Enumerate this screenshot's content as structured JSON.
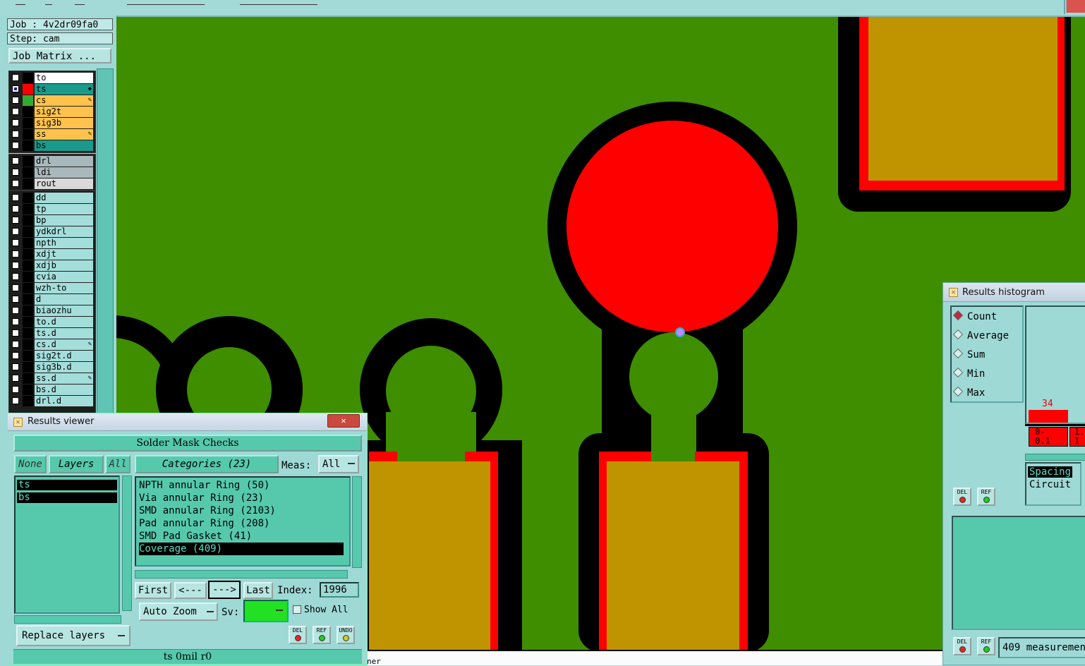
{
  "left_panel": {
    "job": "Job : 4v2dr09fa0",
    "step": "Step: cam",
    "job_matrix": "Job Matrix ...",
    "layers_group1": [
      {
        "name": "to",
        "color": "#ffffff",
        "swatch": "#000000",
        "checked": false,
        "mark": ""
      },
      {
        "name": "ts",
        "color": "#1a9a8a",
        "swatch": "#ff0000",
        "checked": true,
        "mark": "◆"
      },
      {
        "name": "cs",
        "color": "#ffc34d",
        "swatch": "#33aa33",
        "checked": false,
        "mark": "✎"
      },
      {
        "name": "sig2t",
        "color": "#ffc34d",
        "swatch": "#000000",
        "checked": false,
        "mark": ""
      },
      {
        "name": "sig3b",
        "color": "#ffc34d",
        "swatch": "#000000",
        "checked": false,
        "mark": ""
      },
      {
        "name": "ss",
        "color": "#ffc34d",
        "swatch": "#000000",
        "checked": false,
        "mark": "✎"
      },
      {
        "name": "bs",
        "color": "#1a9a8a",
        "swatch": "#000000",
        "checked": false,
        "mark": ""
      }
    ],
    "layers_group2": [
      {
        "name": "drl",
        "color": "#a9b8bc",
        "swatch": "#000000",
        "checked": false,
        "mark": ""
      },
      {
        "name": "ldi",
        "color": "#a9b8bc",
        "swatch": "#000000",
        "checked": false,
        "mark": ""
      },
      {
        "name": "rout",
        "color": "#d9d9d9",
        "swatch": "#000000",
        "checked": false,
        "mark": ""
      }
    ],
    "layers_group3": [
      {
        "name": "dd",
        "mark": ""
      },
      {
        "name": "tp",
        "mark": ""
      },
      {
        "name": "bp",
        "mark": ""
      },
      {
        "name": "ydkdrl",
        "mark": ""
      },
      {
        "name": "npth",
        "mark": ""
      },
      {
        "name": "xdjt",
        "mark": ""
      },
      {
        "name": "xdjb",
        "mark": ""
      },
      {
        "name": "cvia",
        "mark": ""
      },
      {
        "name": "wzh-to",
        "mark": ""
      },
      {
        "name": "d",
        "mark": ""
      },
      {
        "name": "biaozhu",
        "mark": ""
      },
      {
        "name": "to.d",
        "mark": ""
      },
      {
        "name": "ts.d",
        "mark": ""
      },
      {
        "name": "cs.d",
        "mark": "✎"
      },
      {
        "name": "sig2t.d",
        "mark": ""
      },
      {
        "name": "sig3b.d",
        "mark": ""
      },
      {
        "name": "ss.d",
        "mark": "✎"
      },
      {
        "name": "bs.d",
        "mark": ""
      },
      {
        "name": "drl.d",
        "mark": ""
      }
    ]
  },
  "results_viewer": {
    "title": "Results viewer",
    "close": "✕",
    "check_name": "Solder Mask Checks",
    "none_btn": "None",
    "layers_btn": "Layers",
    "all_btn": "All",
    "categories_btn": "Categories (23)",
    "meas_label": "Meas:",
    "meas_value": "All",
    "layers": [
      "ts",
      "bs"
    ],
    "categories": [
      "NPTH annular Ring (50)",
      "Via annular Ring (23)",
      "SMD annular Ring (2103)",
      "Pad annular Ring (208)",
      "SMD Pad Gasket (41)",
      "Coverage (409)"
    ],
    "selected_category_index": 5,
    "first_btn": "First",
    "prev_btn": "<---",
    "next_btn": "--->",
    "last_btn": "Last",
    "index_label": "Index:",
    "index_value": "1996",
    "auto_zoom": "Auto Zoom",
    "sv_label": "Sv:",
    "show_all": "Show All",
    "replace_layers": "Replace layers",
    "del": "DEL",
    "ref": "REF",
    "undo": "UNDO",
    "status": "ts 0mil  r0"
  },
  "histogram": {
    "title": "Results histogram",
    "modes": [
      "Count",
      "Average",
      "Sum",
      "Min",
      "Max"
    ],
    "selected_mode": "Count",
    "bar_value": "34",
    "bin1": "0-\n0.1",
    "bin2": "1.\n1",
    "types": [
      "Spacing",
      "Circuit"
    ],
    "del": "DEL",
    "ref": "REF",
    "footer": "409 measuremen"
  },
  "canvas": {
    "bottom_text": "ner"
  },
  "colors": {
    "board_green": "#3e8e00",
    "pad_red": "#ff0000",
    "pad_gold": "#c09400",
    "mask_black": "#000000",
    "panel_teal": "#9ed9d6"
  }
}
